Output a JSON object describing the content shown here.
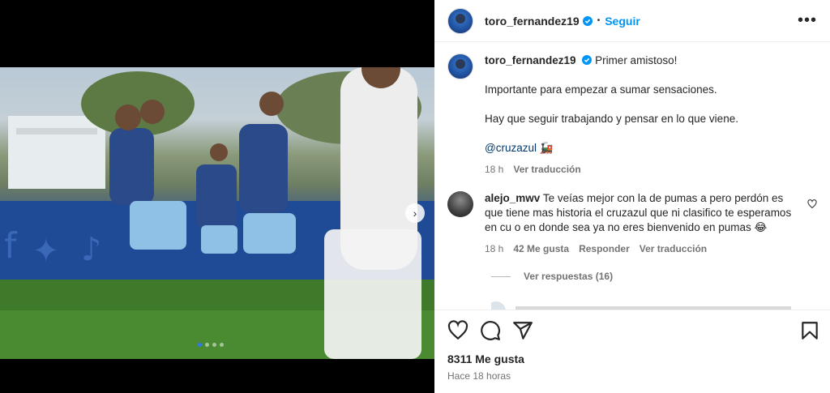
{
  "post": {
    "username": "toro_fernandez19",
    "follow_label": "Seguir",
    "bullet": "•",
    "more_label": "•••"
  },
  "caption": {
    "username": "toro_fernandez19",
    "line1": "Primer amistoso!",
    "line2": "Importante para empezar a sumar sensaciones.",
    "line3": "Hay que seguir trabajando y pensar en lo que viene.",
    "mention": "@cruzazul",
    "emoji": "🚂",
    "time": "18 h",
    "translate": "Ver traducción"
  },
  "comment": {
    "username": "alejo_mwv",
    "text": "Te veías mejor con la de pumas a pero perdón es que tiene mas historia el cruzazul que ni clasifico te esperamos en cu o en donde sea ya no eres bienvenido en pumas 😂",
    "time": "18 h",
    "likes": "42 Me gusta",
    "reply": "Responder",
    "translate": "Ver traducción",
    "view_replies": "Ver respuestas (16)"
  },
  "footer": {
    "likes": "8311 Me gusta",
    "time": "Hace 18 horas"
  },
  "carousel": {
    "next_icon": "chevron-right-icon",
    "slides": 4,
    "active_index": 0
  },
  "colors": {
    "accent": "#0095f6",
    "text": "#262626",
    "muted": "#737373",
    "verified": "#0095f6"
  }
}
